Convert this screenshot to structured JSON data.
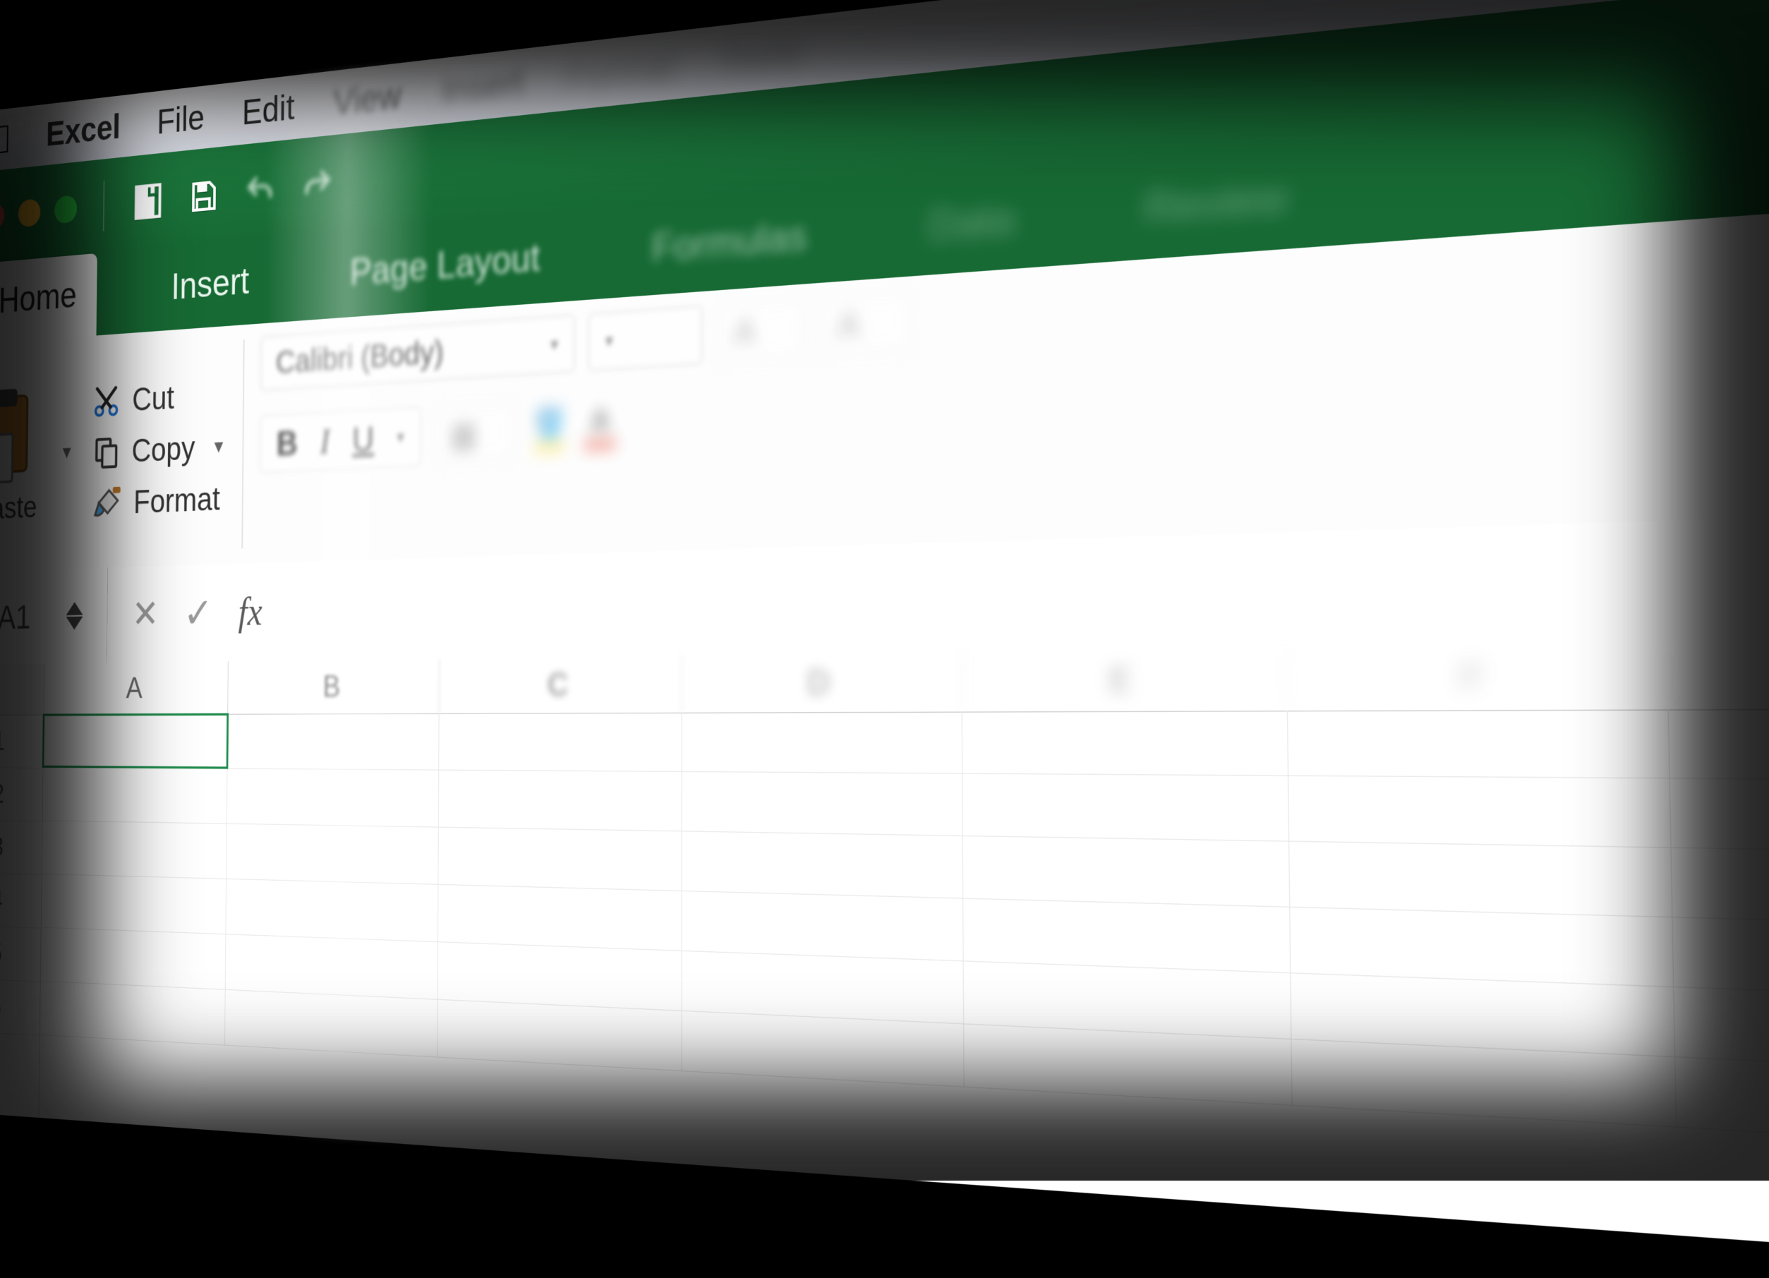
{
  "menubar": {
    "app": "Excel",
    "items": [
      "File",
      "Edit",
      "View",
      "Insert",
      "Format",
      "Tools"
    ]
  },
  "ribbon_tabs": [
    "Home",
    "Insert",
    "Page Layout",
    "Formulas",
    "Data",
    "Review"
  ],
  "clipboard": {
    "paste_label": "Paste",
    "cut_label": "Cut",
    "copy_label": "Copy",
    "format_label": "Format"
  },
  "font": {
    "name": "Calibri (Body)",
    "bold": "B",
    "italic": "I",
    "underline": "U"
  },
  "formula_bar": {
    "name_box": "A1",
    "fx_label": "fx"
  },
  "columns": [
    "A",
    "B",
    "C",
    "D",
    "E",
    "F"
  ]
}
